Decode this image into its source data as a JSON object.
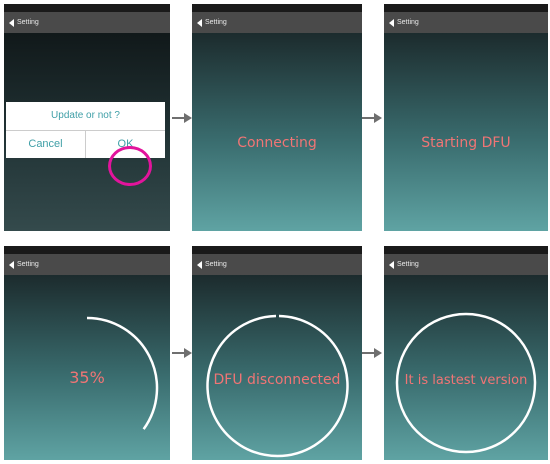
{
  "nav": {
    "title": "Setting"
  },
  "dialog": {
    "title": "Update or not ?",
    "cancel": "Cancel",
    "ok": "OK"
  },
  "screens": {
    "connecting": "Connecting",
    "starting": "Starting DFU",
    "progress": {
      "label": "35%",
      "fraction": 0.35
    },
    "disconnected": "DFU disconnected",
    "latest": "It is lastest version"
  },
  "colors": {
    "navbar": "#4a4a4a",
    "message": "#f07575",
    "dialog_text": "#3f9fa7",
    "highlight": "#e2149c",
    "arrow": "#6f6f6f"
  }
}
